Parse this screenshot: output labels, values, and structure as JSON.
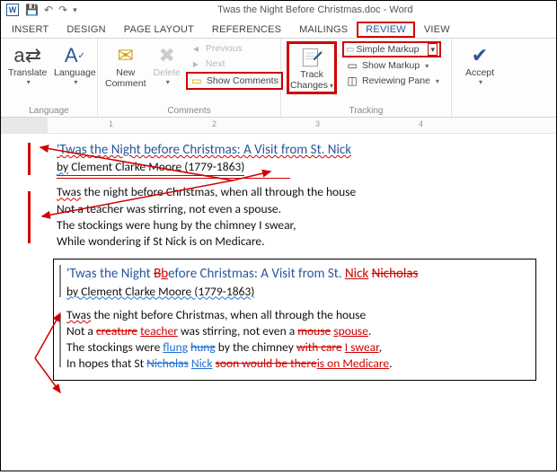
{
  "window": {
    "title": "Twas the Night Before Christmas.doc - Word"
  },
  "tabs": {
    "insert": "INSERT",
    "design": "DESIGN",
    "pagelayout": "PAGE LAYOUT",
    "references": "REFERENCES",
    "mailings": "MAILINGS",
    "review": "REVIEW",
    "view": "VIEW"
  },
  "ribbon": {
    "language": {
      "translate": "Translate",
      "language": "Language",
      "group": "Language"
    },
    "comments": {
      "new_comment_l1": "New",
      "new_comment_l2": "Comment",
      "delete": "Delete",
      "previous": "Previous",
      "next": "Next",
      "show_comments": "Show Comments",
      "group": "Comments"
    },
    "tracking": {
      "track_l1": "Track",
      "track_l2": "Changes",
      "markup_mode": "Simple Markup",
      "show_markup": "Show Markup",
      "reviewing_pane": "Reviewing Pane",
      "group": "Tracking"
    },
    "changes": {
      "accept": "Accept"
    }
  },
  "ruler": {
    "m1": "1",
    "m2": "2",
    "m3": "3",
    "m4": "4"
  },
  "doc": {
    "title": "'Twas the Night before Christmas: A Visit from St. Nick",
    "author_by": "by",
    "author_name": "Clement Clarke Moore",
    "author_dates": "(1779-1863)",
    "p1": "the night before Christmas, when all through the house",
    "p1_first": "Twas",
    "p2": "Not a teacher was stirring, not even a spouse.",
    "p3": "The stockings were hung by the chimney I swear,",
    "p4": "While wondering if St Nick is on Medicare."
  },
  "inset": {
    "title_a": "'Twas the Night ",
    "title_del": "B",
    "title_ins": "b",
    "title_b": "efore Christmas: A Visit from St. ",
    "title_nick": "Nick",
    "title_nicholas": "Nicholas",
    "author": "by Clement Clarke Moore (1779-1863)",
    "l1_first": "Twas",
    "l1_rest": " the night before Christmas, when all through the house",
    "l2_a": "Not a ",
    "l2_del1": "creature",
    "l2_ins1": "teacher",
    "l2_b": " was stirring, not even a ",
    "l2_del2": "mouse",
    "l2_ins2": "spouse",
    "l2_c": ".",
    "l3_a": "The stockings were ",
    "l3_ins": "flung",
    "l3_del": "hung",
    "l3_b": " by the chimney ",
    "l3_del2": "with care",
    "l3_ins2": "I swear",
    "l3_c": ",",
    "l4_a": "In hopes that St ",
    "l4_del1": "Nicholas",
    "l4_ins1": "Nick",
    "l4_del2": "soon would be there",
    "l4_ins2": "is on Medicare",
    "l4_c": "."
  }
}
